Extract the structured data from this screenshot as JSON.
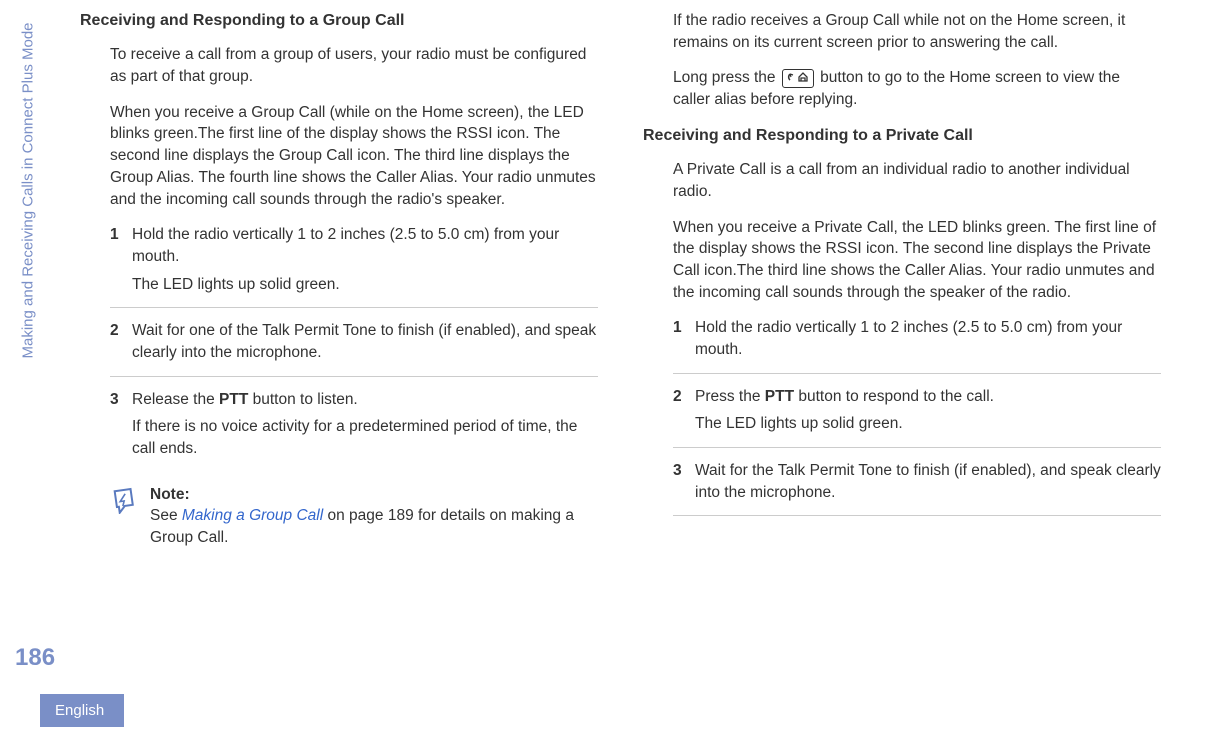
{
  "margin": {
    "vertical_label": "Making and Receiving Calls in Connect Plus Mode",
    "page_number": "186",
    "language": "English"
  },
  "col1": {
    "heading": "Receiving and Responding to a Group Call",
    "p1": "To receive a call from a group of users, your radio must be configured as part of that group.",
    "p2": "When you receive a Group Call (while on the Home screen), the LED blinks green.The first line of the display shows the RSSI icon. The second line displays the Group Call icon. The third line displays the Group Alias. The fourth line shows the Caller Alias. Your radio unmutes and the incoming call sounds through the radio's speaker.",
    "steps": {
      "s1n": "1",
      "s1a": "Hold the radio vertically 1 to 2 inches (2.5 to 5.0 cm) from your mouth.",
      "s1b": "The LED lights up solid green.",
      "s2n": "2",
      "s2": "Wait for one of the Talk Permit Tone to finish (if enabled), and speak clearly into the microphone.",
      "s3n": "3",
      "s3a_pre": "Release the ",
      "s3a_bold": "PTT",
      "s3a_post": " button to listen.",
      "s3b": "If there is no voice activity for a predetermined period of time, the call ends."
    },
    "note": {
      "label": "Note:",
      "pre": "See ",
      "link": "Making a Group Call",
      "post": " on page 189 for details on making a Group Call."
    }
  },
  "col2": {
    "p1": "If the radio receives a Group Call while not on the Home screen, it remains on its current screen prior to answering the call.",
    "p2_pre": "Long press the ",
    "p2_post": " button to go to the Home screen to view the caller alias before replying.",
    "heading": "Receiving and Responding to a Private Call",
    "p3": "A Private Call is a call from an individual radio to another individual radio.",
    "p4": "When you receive a Private Call, the LED blinks green. The first line of the display shows the RSSI icon. The second line displays the Private Call icon.The third line shows the Caller Alias. Your radio unmutes and the incoming call sounds through the speaker of the radio.",
    "steps": {
      "s1n": "1",
      "s1": "Hold the radio vertically 1 to 2 inches (2.5 to 5.0 cm) from your mouth.",
      "s2n": "2",
      "s2a_pre": "Press the ",
      "s2a_bold": "PTT",
      "s2a_post": " button to respond to the call.",
      "s2b": "The LED lights up solid green.",
      "s3n": "3",
      "s3": "Wait for the Talk Permit Tone to finish (if enabled), and speak clearly into the microphone."
    }
  }
}
